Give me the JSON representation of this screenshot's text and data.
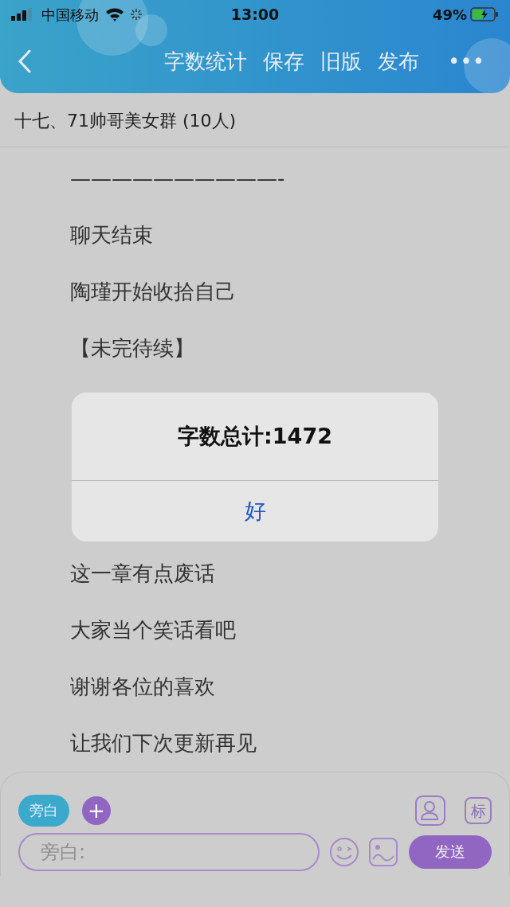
{
  "status_bar": {
    "carrier": "中国移动",
    "time": "13:00",
    "battery": "49%"
  },
  "navbar": {
    "actions": [
      "字数统计",
      "保存",
      "旧版",
      "发布"
    ],
    "more": "•••"
  },
  "chapter_title": "十七、71帅哥美女群 (10人)",
  "content_before_dialog": [
    "——————————-",
    "聊天结束",
    "陶瑾开始收拾自己",
    "【未完待续】"
  ],
  "content_after_dialog": [
    "这一章有点废话",
    "大家当个笑话看吧",
    "谢谢各位的喜欢",
    "让我们下次更新再见"
  ],
  "dialog": {
    "message": "字数总计:1472",
    "button": "好"
  },
  "composer": {
    "role_tag": "旁白",
    "add": "+",
    "mark_button": "标",
    "placeholder": "旁白:",
    "send": "发送"
  }
}
